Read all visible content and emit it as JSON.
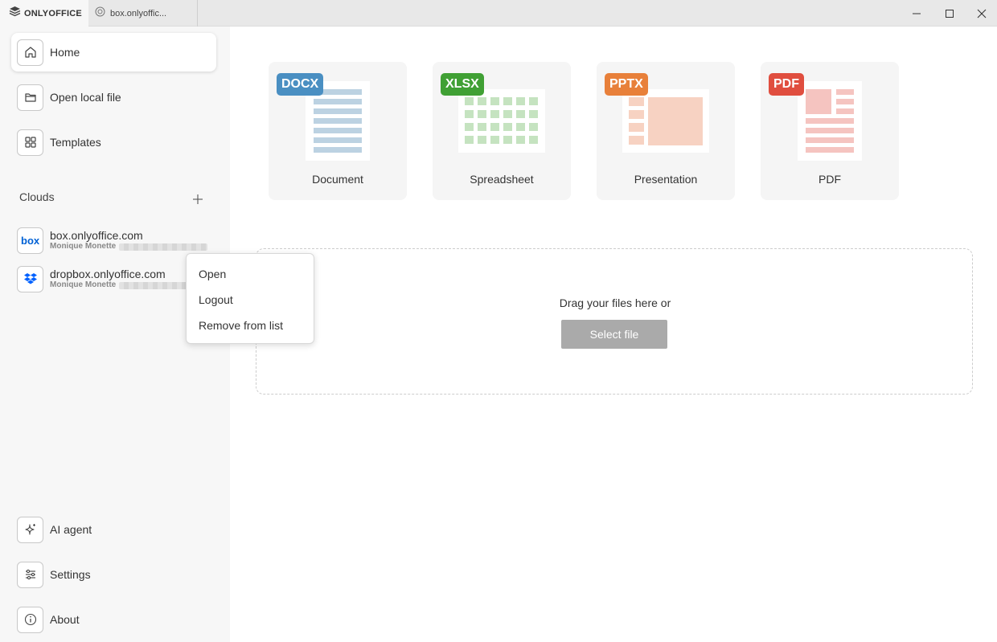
{
  "titlebar": {
    "app_name": "ONLYOFFICE",
    "cloud_tab_label": "box.onlyoffic..."
  },
  "sidebar": {
    "nav": [
      {
        "label": "Home",
        "icon": "home-icon",
        "active": true
      },
      {
        "label": "Open local file",
        "icon": "folder-icon"
      },
      {
        "label": "Templates",
        "icon": "templates-grid-icon"
      }
    ],
    "clouds_header": "Clouds",
    "clouds": [
      {
        "name": "box.onlyoffice.com",
        "user": "Monique Monette",
        "icon": "box-logo-icon"
      },
      {
        "name": "dropbox.onlyoffice.com",
        "user": "Monique Monette",
        "icon": "dropbox-logo-icon"
      }
    ],
    "bottom": [
      {
        "label": "AI agent",
        "icon": "ai-sparkle-icon"
      },
      {
        "label": "Settings",
        "icon": "sliders-icon"
      },
      {
        "label": "About",
        "icon": "info-icon"
      }
    ]
  },
  "create": [
    {
      "badge": "DOCX",
      "label": "Document",
      "color": "#4a8fc2"
    },
    {
      "badge": "XLSX",
      "label": "Spreadsheet",
      "color": "#40a034"
    },
    {
      "badge": "PPTX",
      "label": "Presentation",
      "color": "#e8803a"
    },
    {
      "badge": "PDF",
      "label": "PDF",
      "color": "#e04e3f"
    }
  ],
  "dropzone": {
    "text": "Drag your files here or",
    "button": "Select file"
  },
  "context_menu": {
    "items": [
      "Open",
      "Logout",
      "Remove from list"
    ]
  }
}
